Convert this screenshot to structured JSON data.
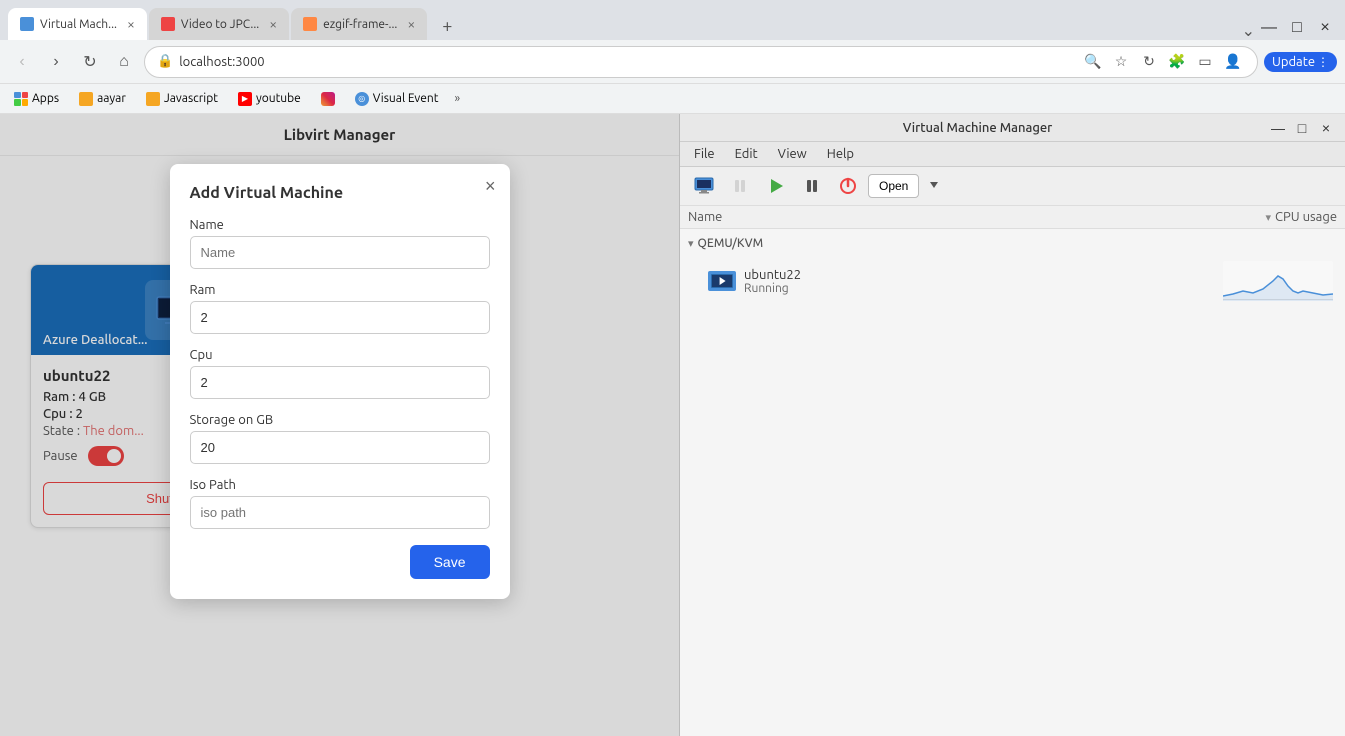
{
  "browser": {
    "tabs": [
      {
        "id": "tab1",
        "title": "Virtual Mach...",
        "favicon_color": "#4a90d9",
        "active": true
      },
      {
        "id": "tab2",
        "title": "Video to JPC...",
        "favicon_color": "#e44444",
        "active": false
      },
      {
        "id": "tab3",
        "title": "ezgif-frame-...",
        "favicon_color": "#ff8844",
        "active": false
      }
    ],
    "address": "localhost:3000",
    "update_label": "Update",
    "nav": {
      "back": "‹",
      "forward": "›",
      "reload": "↻",
      "home": "⌂"
    }
  },
  "bookmarks": [
    {
      "label": "Apps",
      "type": "apps"
    },
    {
      "label": "aayar",
      "type": "folder"
    },
    {
      "label": "Javascript",
      "type": "folder"
    },
    {
      "label": "youtube",
      "type": "youtube"
    },
    {
      "label": "",
      "type": "instagram"
    },
    {
      "label": "Visual Event",
      "type": "visual"
    }
  ],
  "page": {
    "title": "Libvirt Manager"
  },
  "vm_card": {
    "image_label": "Azure Deallocat...",
    "name": "ubuntu22",
    "ram_label": "Ram :",
    "ram_value": "4 GB",
    "cpu_label": "Cpu :",
    "cpu_value": "2",
    "state_label": "State :",
    "state_value": "The dom...",
    "pause_label": "Pause",
    "shutdown_label": "Shutdown"
  },
  "modal": {
    "title": "Add Virtual Machine",
    "close_label": "×",
    "fields": {
      "name_label": "Name",
      "name_placeholder": "Name",
      "name_value": "",
      "ram_label": "Ram",
      "ram_value": "2",
      "cpu_label": "Cpu",
      "cpu_value": "2",
      "storage_label": "Storage on GB",
      "storage_value": "20",
      "iso_label": "Iso Path",
      "iso_placeholder": "iso path",
      "iso_value": ""
    },
    "save_label": "Save"
  },
  "vmm": {
    "title": "Virtual Machine Manager",
    "menu": [
      "File",
      "Edit",
      "View",
      "Help"
    ],
    "toolbar": {
      "open_label": "Open"
    },
    "columns": {
      "name": "Name",
      "cpu_usage": "CPU usage"
    },
    "group": "QEMU/KVM",
    "vm": {
      "name": "ubuntu22",
      "status": "Running"
    }
  }
}
